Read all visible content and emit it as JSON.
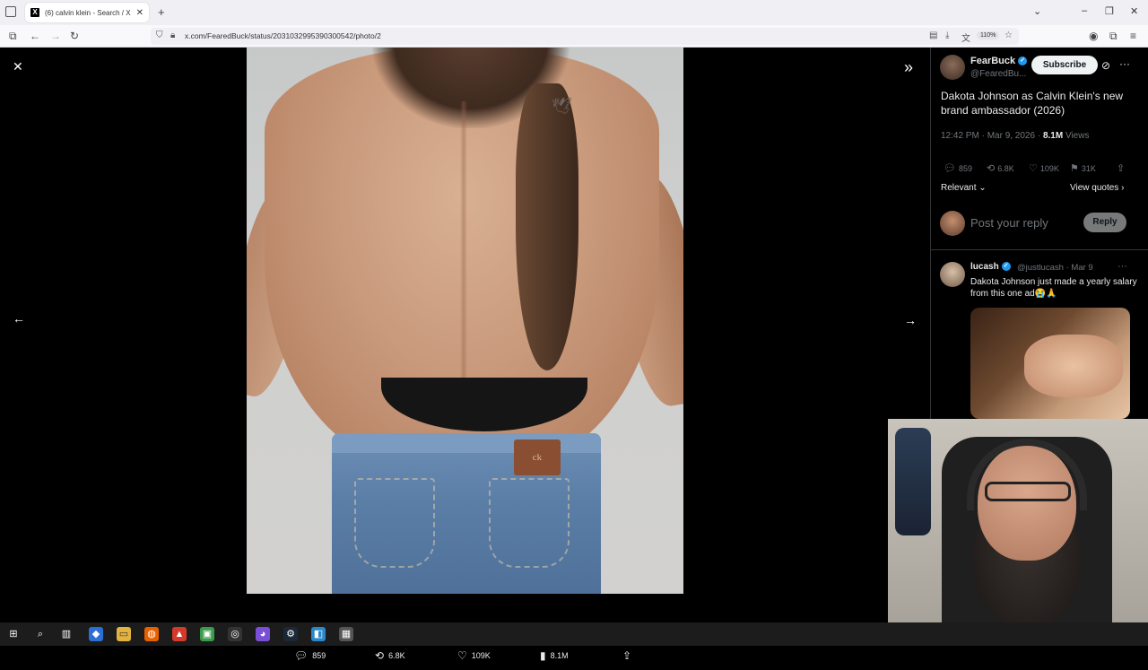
{
  "browser": {
    "tab_title": "(6) calvin klein - Search / X",
    "tab_logo": "X",
    "tab_close": "✕",
    "new_tab": "+",
    "url": "x.com/FearedBuck/status/2031032995390300542/photo/2",
    "zoom": "110%"
  },
  "viewer": {
    "close_icon": "✕",
    "expand_icon": "»",
    "prev_icon": "←",
    "next_icon": "→",
    "actions": {
      "replies": "859",
      "reposts": "6.8K",
      "likes": "109K",
      "views": "8.1M"
    }
  },
  "panel": {
    "author": {
      "name": "FearBuck",
      "handle": "@FearedBu..."
    },
    "subscribe_label": "Subscribe",
    "tweet_text": "Dakota Johnson as Calvin Klein's new brand ambassador (2026)",
    "time": "12:42 PM · Mar 9, 2026 · ",
    "views_count": "8.1M",
    "views_label": " Views",
    "stats": {
      "replies": "859",
      "reposts": "6.8K",
      "likes": "109K",
      "bookmarks": "31K"
    },
    "relevant_label": "Relevant",
    "view_quotes_label": "View quotes",
    "reply_placeholder": "Post your reply",
    "reply_button": "Reply",
    "reply": {
      "name": "lucash",
      "handle": "@justlucash · Mar 9",
      "text": "Dakota Johnson just made a yearly salary from this one ad😭🙏"
    }
  },
  "colors": {
    "accent": "#1d9bf0",
    "background": "#000000",
    "muted": "#71767b",
    "text": "#e7e9ea"
  }
}
